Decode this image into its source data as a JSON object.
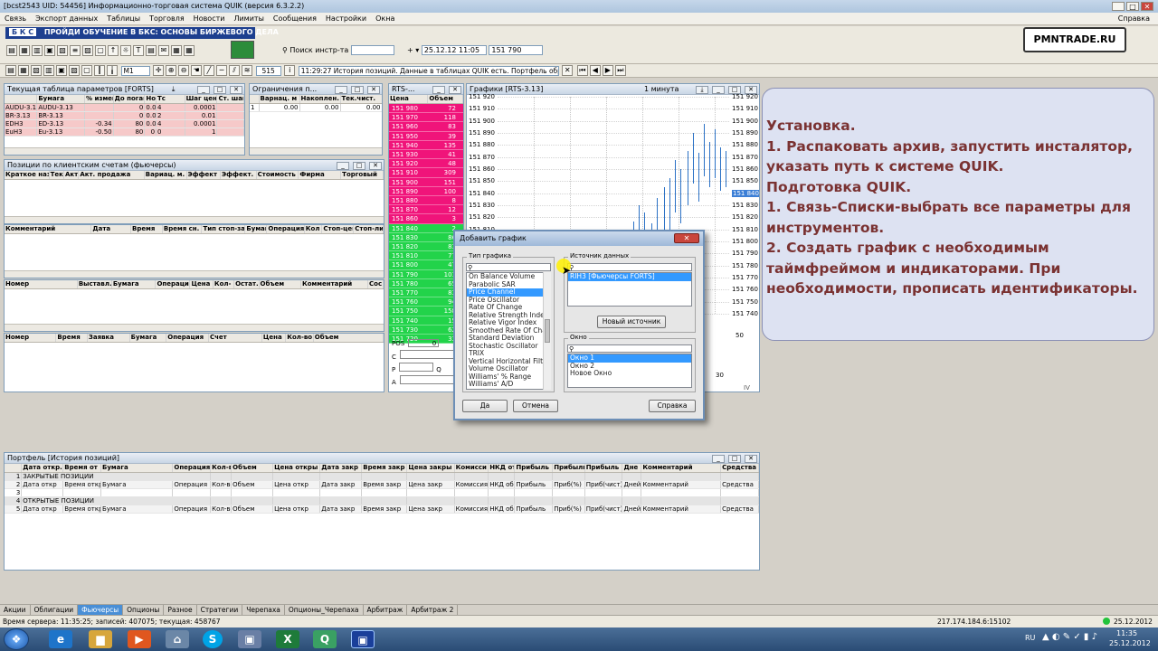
{
  "app": {
    "title": "[bcst2543 UID: 54456] Информационно-торговая система QUIK (версия 6.3.2.2)",
    "window_btns": [
      "_",
      "□",
      "✕"
    ]
  },
  "menu": {
    "items": [
      "Связь",
      "Экспорт данных",
      "Таблицы",
      "Торговля",
      "Новости",
      "Лимиты",
      "Сообщения",
      "Настройки",
      "Окна"
    ],
    "help": "Справка"
  },
  "banner": {
    "logo": "Б К С",
    "text": "ПРОЙДИ ОБУЧЕНИЕ В БКС: ОСНОВЫ БИРЖЕВОГО ДЕЛА"
  },
  "toolbar1": {
    "search_label": "Поиск инстр-та",
    "search_value": "",
    "date_value": "25.12.12 11:05",
    "price_value": "151 790"
  },
  "toolbar2": {
    "interval": "M1",
    "count": "515",
    "message": "11:29:27 История позиций. Данные в таблицах QUIK есть. Портфель обработ."
  },
  "brand": {
    "text": "PMNTRADE.RU"
  },
  "params_window": {
    "title": "Текущая таблица параметров [FORTS]",
    "headers": [
      "Бумага",
      "% измен.закр.",
      "До погаш",
      "Номи",
      "Тс",
      "Шаг цены",
      "Ст. шага"
    ],
    "rows": [
      [
        "AUDU-3.13",
        "",
        "0",
        "0.0000",
        "4",
        "0.0001",
        ""
      ],
      [
        "BR-3.13",
        "",
        "0",
        "0.00",
        "2",
        "0.01",
        ""
      ],
      [
        "ED-3.13",
        "-0.34",
        "80",
        "0.0000",
        "4",
        "0.0001",
        ""
      ],
      [
        "Eu-3.13",
        "-0.50",
        "80",
        "0",
        "0",
        "1",
        ""
      ]
    ],
    "row_labels": [
      "AUDU-3.13",
      "BR-3.13",
      "EDH3",
      "EuH3"
    ]
  },
  "limits_window": {
    "title": "Ограничения п...",
    "headers": [
      "Варнац. м",
      "Накоплен.",
      "Тек.чист."
    ],
    "row": [
      "1",
      "0.00",
      "0.00",
      "0.00"
    ]
  },
  "rts_window": {
    "title": "RTS-...",
    "headers": [
      "Цена",
      "Объем"
    ],
    "sell": [
      [
        "151 980",
        "72"
      ],
      [
        "151 970",
        "118"
      ],
      [
        "151 960",
        "83"
      ],
      [
        "151 950",
        "39"
      ],
      [
        "151 940",
        "135"
      ],
      [
        "151 930",
        "41"
      ],
      [
        "151 920",
        "48"
      ],
      [
        "151 910",
        "309"
      ],
      [
        "151 900",
        "151"
      ],
      [
        "151 890",
        "100"
      ],
      [
        "151 880",
        "8"
      ],
      [
        "151 870",
        "12"
      ],
      [
        "151 860",
        "3"
      ]
    ],
    "buy": [
      [
        "151 840",
        "2"
      ],
      [
        "151 830",
        "86"
      ],
      [
        "151 820",
        "83"
      ],
      [
        "151 810",
        "77"
      ],
      [
        "151 800",
        "47"
      ],
      [
        "151 790",
        "101"
      ],
      [
        "151 780",
        "65"
      ],
      [
        "151 770",
        "83"
      ],
      [
        "151 760",
        "94"
      ],
      [
        "151 750",
        "158"
      ],
      [
        "151 740",
        "15"
      ],
      [
        "151 730",
        "62"
      ],
      [
        "151 720",
        "33"
      ]
    ],
    "pos_label": "POS",
    "pos_value": "0",
    "c_label": "С",
    "p_label": "Р",
    "a_label": "А",
    "q_label": "Q"
  },
  "chart_window": {
    "title": "Графики [RTS-3.13]",
    "interval": "1 минута",
    "y_labels": [
      "151 920",
      "151 910",
      "151 900",
      "151 890",
      "151 880",
      "151 870",
      "151 860",
      "151 850",
      "151 840",
      "151 830",
      "151 820",
      "151 810",
      "151 800",
      "151 790",
      "151 780",
      "151 770",
      "151 760",
      "151 750",
      "151 740"
    ],
    "right_labels": [
      "151 920",
      "151 910",
      "151 900",
      "151 890",
      "151 880",
      "151 870",
      "151 860",
      "151 850",
      "151 840",
      "151 830",
      "151 820",
      "151 810",
      "151 800",
      "151 790",
      "151 780",
      "151 770",
      "151 760",
      "151 750",
      "151 740"
    ],
    "right_highlight": "151 840",
    "osc_label": "50",
    "osc_label2": "30",
    "bottom_label": "IV"
  },
  "positions_window": {
    "title": "Позиции по клиентским счетам (фьючерсы)",
    "headers": [
      "Краткое назв.",
      "Тек",
      "Акт",
      "Акт. продажа",
      "Вариац. м.",
      "Эффект",
      "Эффект.",
      "Стоимость",
      "Фирма",
      "Торговый"
    ]
  },
  "orders_grid": {
    "headers": [
      "Комментарий",
      "Дата",
      "Время",
      "Время сн.",
      "Тип стоп-за",
      "Бумага",
      "Операция",
      "Кол",
      "Стоп-цена",
      "Стоп-ли"
    ]
  },
  "trades_grid": {
    "headers": [
      "Номер",
      "Выставл.",
      "Бумага",
      "Операция",
      "Цена",
      "Кол-",
      "Остат.",
      "Объем",
      "Комментарий",
      "Сос"
    ]
  },
  "deals_grid": {
    "headers": [
      "Номер",
      "Время",
      "Заявка",
      "Бумага",
      "Операция",
      "Счет",
      "Цена",
      "Кол-во",
      "Объем"
    ]
  },
  "dialog": {
    "title": "Добавить график",
    "type_group": "Тип графика",
    "source_group": "Источник данных",
    "window_group": "Окно",
    "chart_types": [
      "On Balance Volume",
      "Parabolic SAR",
      "Price Channel",
      "Price Oscillator",
      "Rate Of Change",
      "Relative Strength Index",
      "Relative Vigor Index",
      "Smoothed Rate Of Change",
      "Standard Deviation",
      "Stochastic Oscillator",
      "TRIX",
      "Vertical Horizontal Filter",
      "Volume Oscillator",
      "Williams' % Range",
      "Williams' A/D"
    ],
    "selected_type_index": 2,
    "sources": [
      "RIH3 [Фьючерсы FORTS]"
    ],
    "new_source_button": "Новый источник",
    "windows": [
      "Окно 1",
      "Окно 2",
      "Новое Окно"
    ],
    "ok_button": "Да",
    "cancel_button": "Отмена",
    "help_button": "Справка"
  },
  "note": {
    "lines": [
      "Установка.",
      "    1. Распаковать архив, запустить инсталятор,",
      "указать путь к системе QUIK.",
      "",
      "Подготовка QUIK.",
      "    1. Связь-Списки-выбрать все параметры для",
      "инструментов.",
      "    2. Создать график с необходимым",
      "таймфреймом и индикаторами. При",
      "необходимости, прописать идентификаторы."
    ]
  },
  "portfolio_window": {
    "title": "Портфель [История позиций]",
    "headers": [
      "",
      "Дата откр.",
      "Время от",
      "Бумага",
      "Операция",
      "Кол-в",
      "Объем",
      "Цена откры",
      "Дата закр",
      "Время закр",
      "Цена закры",
      "Комисси",
      "НКД от",
      "Прибыль",
      "Прибыль",
      "Прибыль",
      "Дне",
      "Комментарий",
      "Средства"
    ],
    "rows": [
      [
        "1",
        "ЗАКРЫТЫЕ ПОЗИЦИИ",
        "",
        "",
        "",
        "",
        "",
        "",
        "",
        "",
        "",
        "",
        "",
        "",
        "",
        "",
        "",
        "",
        ""
      ],
      [
        "2",
        "Дата откр",
        "Время откр",
        "Бумага",
        "Операция",
        "Кол-во",
        "Объем",
        "Цена откр",
        "Дата закр",
        "Время закр",
        "Цена закр",
        "Комиссия",
        "НКД об",
        "Прибыль",
        "Приб(%)",
        "Приб(чист)",
        "Дней",
        "Комментарий",
        "Средства"
      ],
      [
        "3",
        "",
        "",
        "",
        "",
        "",
        "",
        "",
        "",
        "",
        "",
        "",
        "",
        "",
        "",
        "",
        "",
        "",
        ""
      ],
      [
        "4",
        "ОТКРЫТЫЕ ПОЗИЦИИ",
        "",
        "",
        "",
        "",
        "",
        "",
        "",
        "",
        "",
        "",
        "",
        "",
        "",
        "",
        "",
        "",
        ""
      ],
      [
        "5",
        "Дата откр",
        "Время откр",
        "Бумага",
        "Операция",
        "Кол-во",
        "Объем",
        "Цена откр",
        "Дата закр",
        "Время закр",
        "Цена закр",
        "Комиссия",
        "НКД об",
        "Прибыль",
        "Приб(%)",
        "Приб(чист)",
        "Дней",
        "Комментарий",
        "Средства"
      ]
    ]
  },
  "tabs": {
    "items": [
      "Акции",
      "Облигации",
      "Фьючерсы",
      "Опционы",
      "Разное",
      "Стратегии",
      "Черепаха",
      "Опционы_Черепаха",
      "Арбитраж",
      "Арбитраж 2"
    ],
    "active_index": 2
  },
  "status": {
    "server_time": "Время сервера: 11:35:25; записей: 407075; текущая: 458767",
    "connection": "217.174.184.6:15102",
    "date": "25.12.2012"
  },
  "taskbar": {
    "lang": "RU",
    "time": "11:35",
    "date": "25.12.2012"
  },
  "colors": {
    "pink": "#f0147a",
    "green": "#22d34a",
    "accent": "#3399ff"
  }
}
